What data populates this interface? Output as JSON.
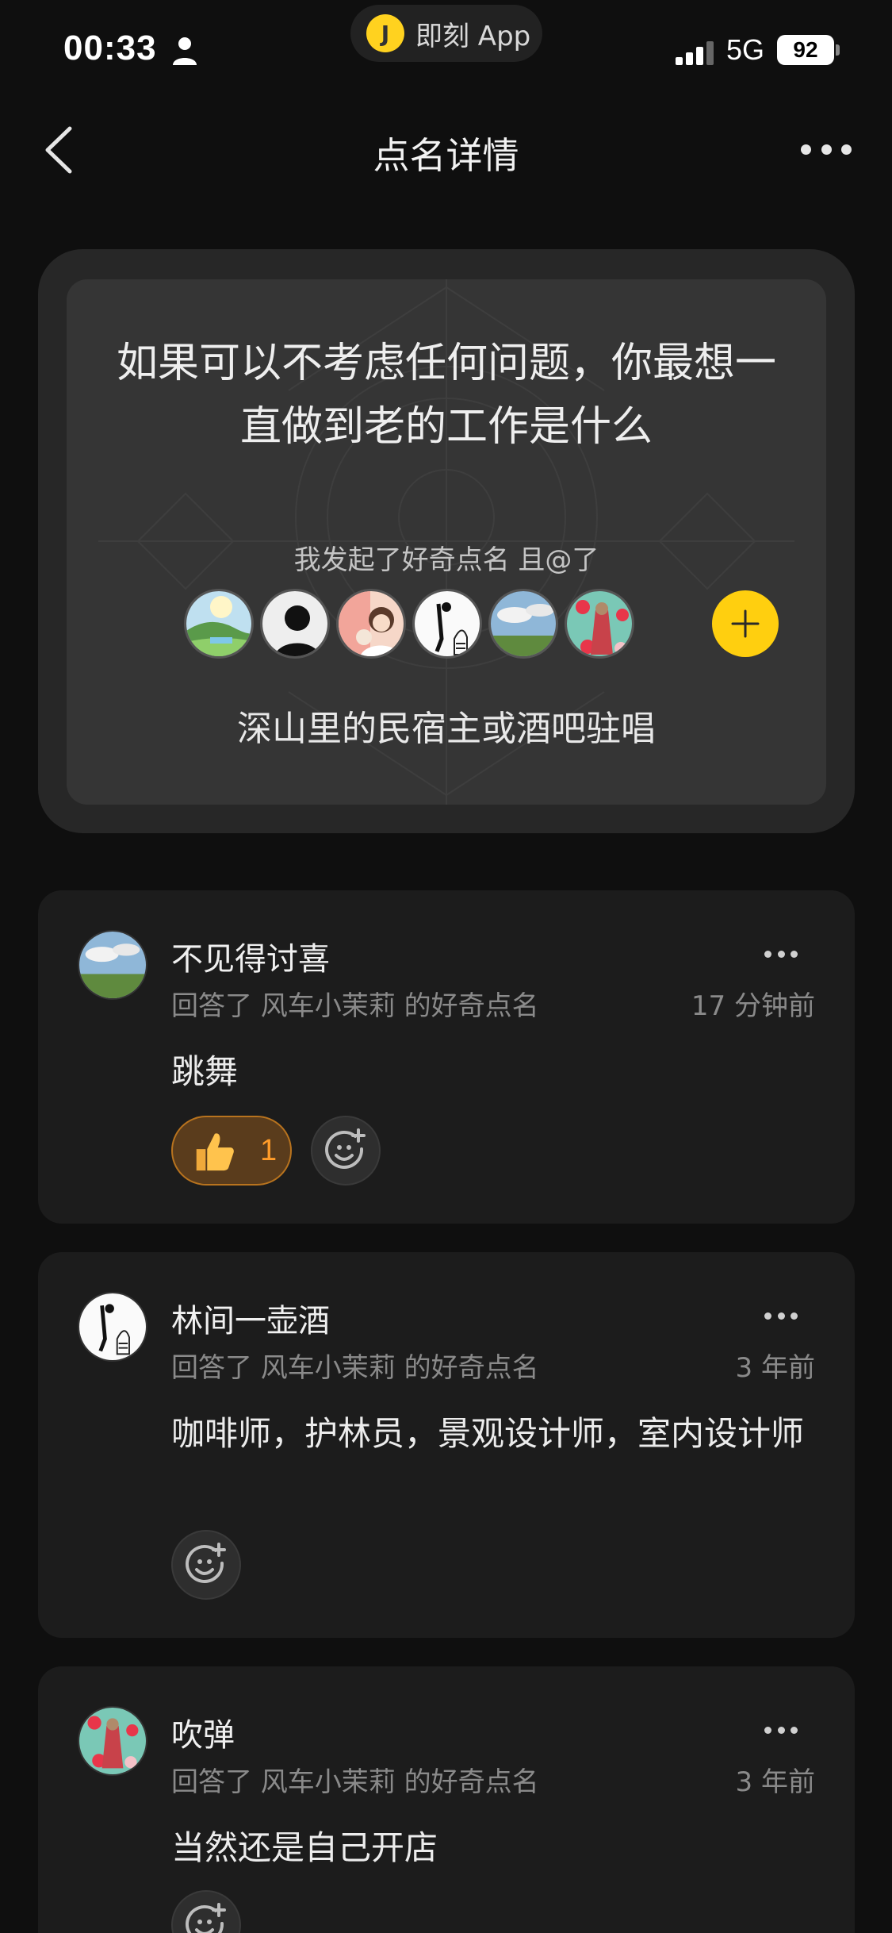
{
  "status_bar": {
    "time": "00:33",
    "app_pill_logo": "J",
    "app_pill_label": "即刻 App",
    "network": "5G",
    "battery": "92"
  },
  "nav": {
    "title": "点名详情"
  },
  "question": {
    "text": "如果可以不考虑任何问题，你最想一直做到老的工作是什么",
    "initiator_line": "我发起了好奇点名 且@了",
    "my_answer": "深山里的民宿主或酒吧驻唱",
    "mentioned_avatars": [
      "landscape-avatar",
      "silhouette-avatar",
      "illustration-avatar",
      "sketch-avatar",
      "sky-field-avatar",
      "floral-avatar"
    ]
  },
  "answers": [
    {
      "name": "不见得讨喜",
      "meta": "回答了 风车小茉莉 的好奇点名",
      "time": "17 分钟前",
      "body": "跳舞",
      "likes": "1",
      "avatar": "sky-field-avatar"
    },
    {
      "name": "林间一壶酒",
      "meta": "回答了 风车小茉莉 的好奇点名",
      "time": "3 年前",
      "body": "咖啡师，护林员，景观设计师，室内设计师",
      "avatar": "sketch-avatar"
    },
    {
      "name": "吹弹",
      "meta": "回答了 风车小茉莉 的好奇点名",
      "time": "3 年前",
      "body": "当然还是自己开店",
      "avatar": "floral-avatar"
    }
  ],
  "colors": {
    "background": "#0f0f0f",
    "card": "#1c1c1c",
    "accent_yellow": "#ffcf0f",
    "like_orange": "#ff9c2a"
  }
}
